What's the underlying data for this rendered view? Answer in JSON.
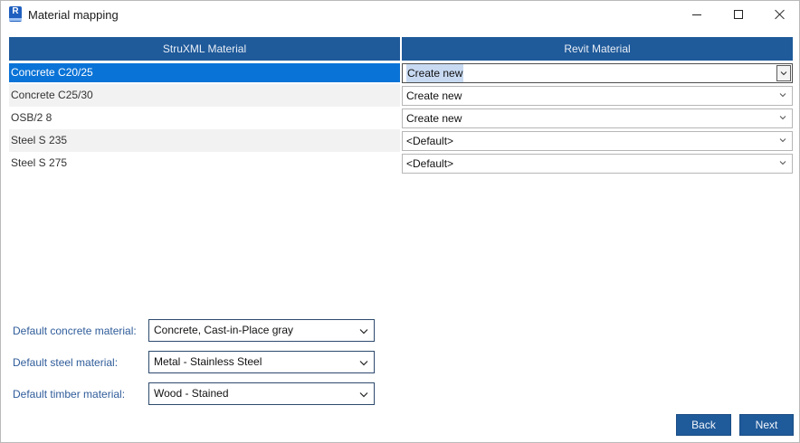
{
  "window": {
    "title": "Material mapping",
    "app_icon_letter": "R"
  },
  "grid": {
    "columns": [
      "StruXML Material",
      "Revit Material"
    ],
    "rows": [
      {
        "material": "Concrete C20/25",
        "revit": "Create new",
        "selected": true
      },
      {
        "material": "Concrete C25/30",
        "revit": "Create new"
      },
      {
        "material": "OSB/2 8",
        "revit": "Create new"
      },
      {
        "material": "Steel S 235",
        "revit": "<Default>"
      },
      {
        "material": "Steel S 275",
        "revit": "<Default>"
      }
    ]
  },
  "defaults": [
    {
      "label": "Default concrete material:",
      "value": "Concrete, Cast-in-Place gray"
    },
    {
      "label": "Default steel material:",
      "value": "Metal - Stainless Steel"
    },
    {
      "label": "Default timber material:",
      "value": "Wood - Stained"
    }
  ],
  "buttons": {
    "back": "Back",
    "next": "Next"
  },
  "colors": {
    "header_bg": "#1f5a9a",
    "selection": "#0a73d7",
    "label_text": "#2f5c9a"
  }
}
